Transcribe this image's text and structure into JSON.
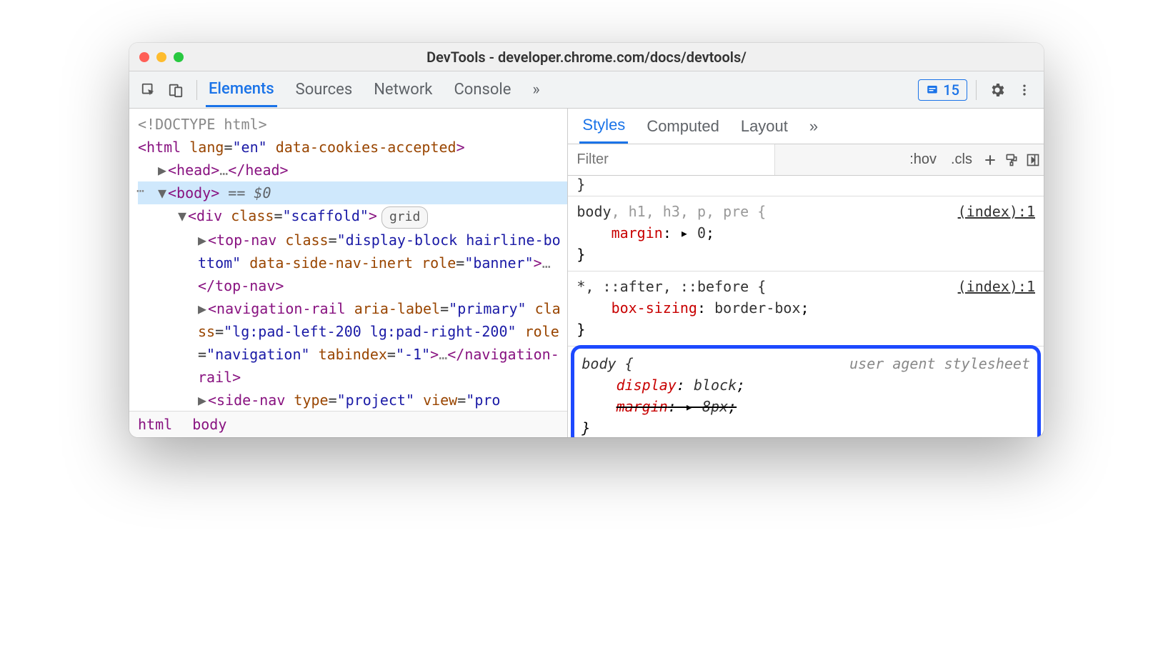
{
  "window": {
    "title": "DevTools - developer.chrome.com/docs/devtools/"
  },
  "tabs": {
    "elements": "Elements",
    "sources": "Sources",
    "network": "Network",
    "console": "Console",
    "more": "»"
  },
  "issues_count": "15",
  "dom": {
    "doctype": "<!DOCTYPE html>",
    "html_open": "<html lang=\"en\" data-cookies-accepted>",
    "head": "<head>…</head>",
    "body_open": "<body>",
    "body_suffix": " == $0",
    "scaffold": "<div class=\"scaffold\">",
    "scaffold_badge": "grid",
    "topnav": "<top-nav class=\"display-block hairline-bottom\" data-side-nav-inert role=\"banner\">…</top-nav>",
    "navrail": "<navigation-rail aria-label=\"primary\" class=\"lg:pad-left-200 lg:pad-right-200\" role=\"navigation\" tabindex=\"-1\">…</navigation-rail>",
    "sidenav": "<side-nav type=\"project\" view=\"project\""
  },
  "crumbs": {
    "html": "html",
    "body": "body"
  },
  "subtabs": {
    "styles": "Styles",
    "computed": "Computed",
    "layout": "Layout",
    "more": "»"
  },
  "filter": {
    "placeholder": "Filter",
    "hov": ":hov",
    "cls": ".cls"
  },
  "rules": {
    "r1_sel_main": "body",
    "r1_sel_rest": ", h1, h3, p, pre {",
    "r1_src": "(index):1",
    "r1_prop": "margin",
    "r1_val": "0",
    "r2_sel": "*, ::after, ::before {",
    "r2_src": "(index):1",
    "r2_prop": "box-sizing",
    "r2_val": "border-box",
    "r3_sel": "body {",
    "r3_src": "user agent stylesheet",
    "r3_p1": "display",
    "r3_v1": "block",
    "r3_p2": "margin",
    "r3_v2": "8px"
  }
}
